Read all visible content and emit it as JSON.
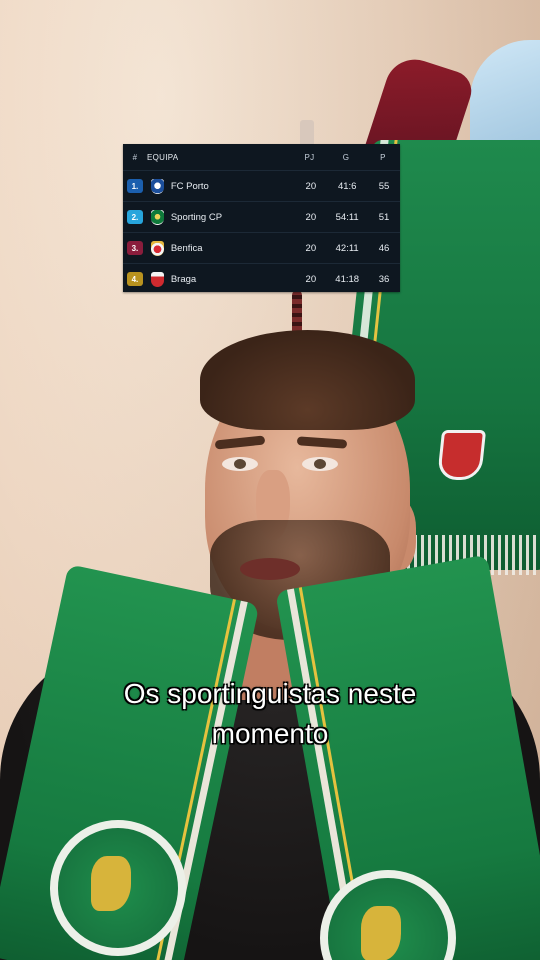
{
  "standings": {
    "headers": {
      "rank": "#",
      "team": "EQUIPA",
      "played": "PJ",
      "goals": "G",
      "points": "P"
    },
    "rows": [
      {
        "rank": "1.",
        "team": "FC Porto",
        "played": "20",
        "goals": "41:6",
        "points": "55",
        "badge_color": "#1b5fae",
        "crest": "fc-porto-crest-icon"
      },
      {
        "rank": "2.",
        "team": "Sporting CP",
        "played": "20",
        "goals": "54:11",
        "points": "51",
        "badge_color": "#27a5dc",
        "crest": "sporting-cp-crest-icon"
      },
      {
        "rank": "3.",
        "team": "Benfica",
        "played": "20",
        "goals": "42:11",
        "points": "46",
        "badge_color": "#8a1d3c",
        "crest": "benfica-crest-icon"
      },
      {
        "rank": "4.",
        "team": "Braga",
        "played": "20",
        "goals": "41:18",
        "points": "36",
        "badge_color": "#b8921f",
        "crest": "braga-crest-icon"
      }
    ]
  },
  "caption": {
    "line1": "Os sportinguistas neste",
    "line2": "momento"
  },
  "colors": {
    "table_bg": "#0e1720",
    "caption_text": "#ffffff",
    "scarf_green": "#1f8a4d"
  }
}
